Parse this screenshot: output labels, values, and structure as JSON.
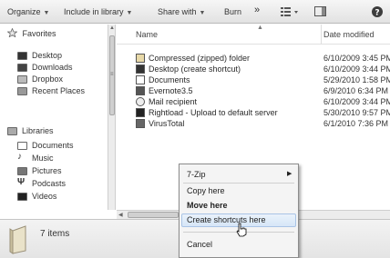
{
  "toolbar": {
    "organize_label": "Organize",
    "include_label": "Include in library",
    "share_label": "Share with",
    "burn_label": "Burn",
    "overflow_label": "»"
  },
  "nav": {
    "favorites_header": "Favorites",
    "favorites": [
      {
        "label": "Desktop",
        "icon": "desktop-icon"
      },
      {
        "label": "Downloads",
        "icon": "downloads-icon"
      },
      {
        "label": "Dropbox",
        "icon": "dropbox-icon"
      },
      {
        "label": "Recent Places",
        "icon": "recent-places-icon"
      }
    ],
    "libraries_header": "Libraries",
    "libraries": [
      {
        "label": "Documents",
        "icon": "documents-icon"
      },
      {
        "label": "Music",
        "icon": "music-icon"
      },
      {
        "label": "Pictures",
        "icon": "pictures-icon"
      },
      {
        "label": "Podcasts",
        "icon": "podcasts-icon"
      },
      {
        "label": "Videos",
        "icon": "videos-icon"
      }
    ]
  },
  "filelist": {
    "col_name": "Name",
    "col_date": "Date modified",
    "rows": [
      {
        "name": "Compressed (zipped) folder",
        "date": "6/10/2009 3:45 PM"
      },
      {
        "name": "Desktop (create shortcut)",
        "date": "6/10/2009 3:44 PM"
      },
      {
        "name": "Documents",
        "date": "5/29/2010 1:58 PM"
      },
      {
        "name": "Evernote3.5",
        "date": "6/9/2010 6:34 PM"
      },
      {
        "name": "Mail recipient",
        "date": "6/10/2009 3:44 PM"
      },
      {
        "name": "Rightload - Upload to default server",
        "date": "5/30/2010 9:57 PM"
      },
      {
        "name": "VirusTotal",
        "date": "6/1/2010 7:36 PM"
      }
    ]
  },
  "details": {
    "item_count": "7 items"
  },
  "context_menu": {
    "items": {
      "zip": "7-Zip",
      "copy": "Copy here",
      "move": "Move here",
      "shortcut": "Create shortcuts here",
      "cancel": "Cancel"
    },
    "highlighted": "Create shortcuts here"
  },
  "colors": {
    "menu_highlight": "#d6e6f7",
    "toolbar_bg": "#e2e2e2"
  }
}
